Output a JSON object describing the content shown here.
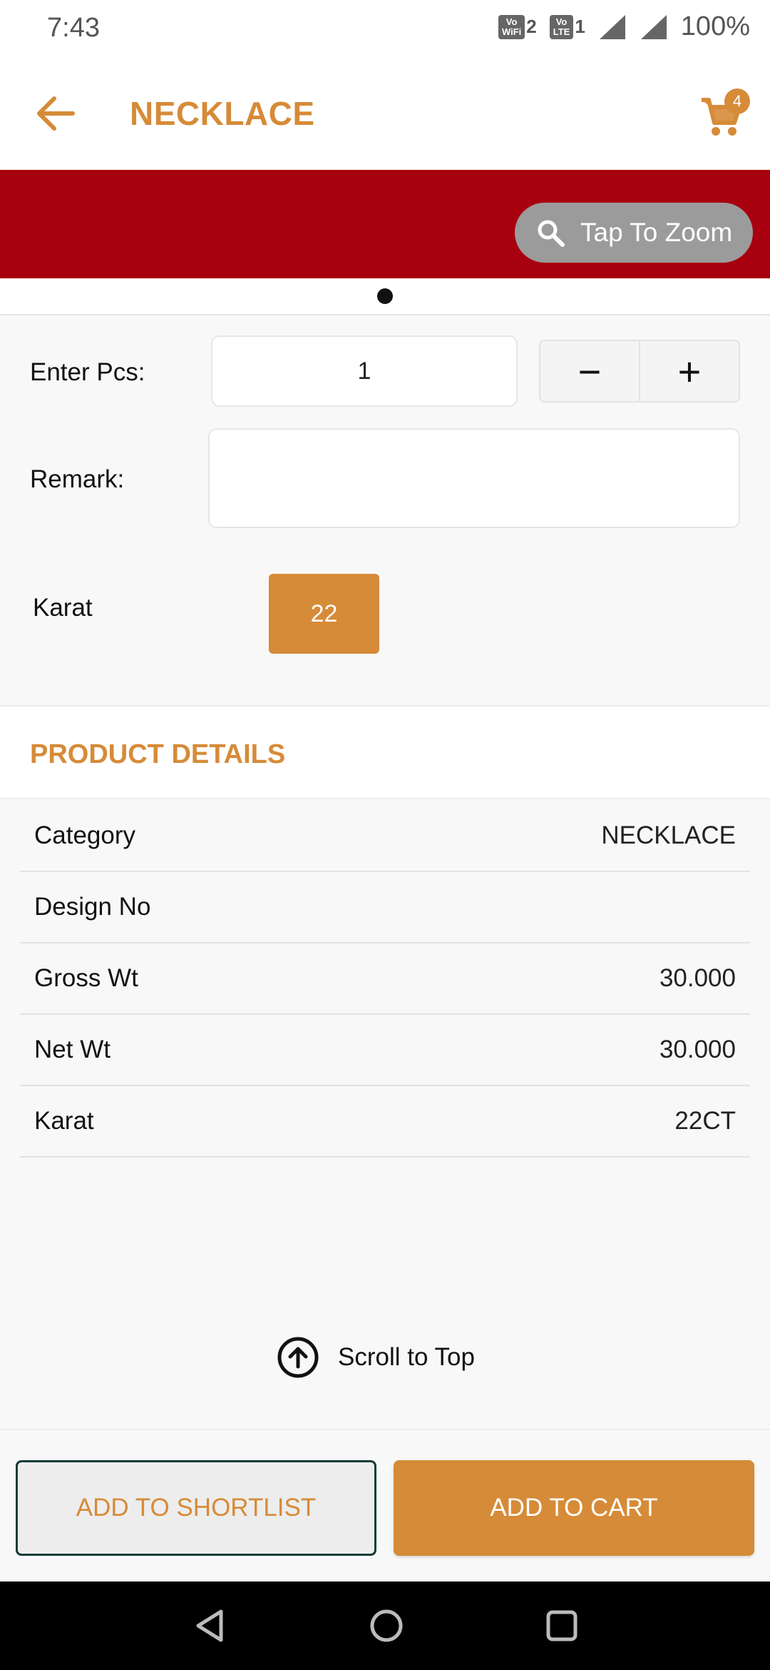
{
  "status": {
    "time": "7:43",
    "wifi_badge_top": "Vo",
    "wifi_badge_bottom": "WiFi",
    "wifi_badge_num": "2",
    "lte_badge_top": "Vo",
    "lte_badge_bottom": "LTE",
    "lte_badge_num": "1",
    "battery": "100%"
  },
  "header": {
    "title": "NECKLACE",
    "cart_count": "4",
    "accent_color": "#d68b38"
  },
  "banner": {
    "zoom_label": "Tap To Zoom",
    "background_color": "#a8000f"
  },
  "form": {
    "pcs_label": "Enter Pcs:",
    "pcs_value": "1",
    "minus_label": "−",
    "plus_label": "+",
    "remark_label": "Remark:",
    "remark_value": "",
    "karat_label": "Karat",
    "karat_option": "22"
  },
  "product_details": {
    "title": "PRODUCT DETAILS",
    "rows": [
      {
        "key": "Category",
        "value": "NECKLACE"
      },
      {
        "key": "Design No",
        "value": ""
      },
      {
        "key": "Gross Wt",
        "value": "30.000"
      },
      {
        "key": "Net Wt",
        "value": "30.000"
      },
      {
        "key": "Karat",
        "value": "22CT"
      }
    ]
  },
  "scroll_top_label": "Scroll to Top",
  "actions": {
    "shortlist_label": "ADD TO SHORTLIST",
    "cart_label": "ADD TO CART"
  },
  "icons": {
    "back": "arrow-left-icon",
    "cart": "cart-icon",
    "zoom": "search-icon",
    "scroll_top": "arrow-up-circle-icon",
    "nav_back": "triangle-back-icon",
    "nav_home": "circle-home-icon",
    "nav_recents": "square-recents-icon"
  }
}
